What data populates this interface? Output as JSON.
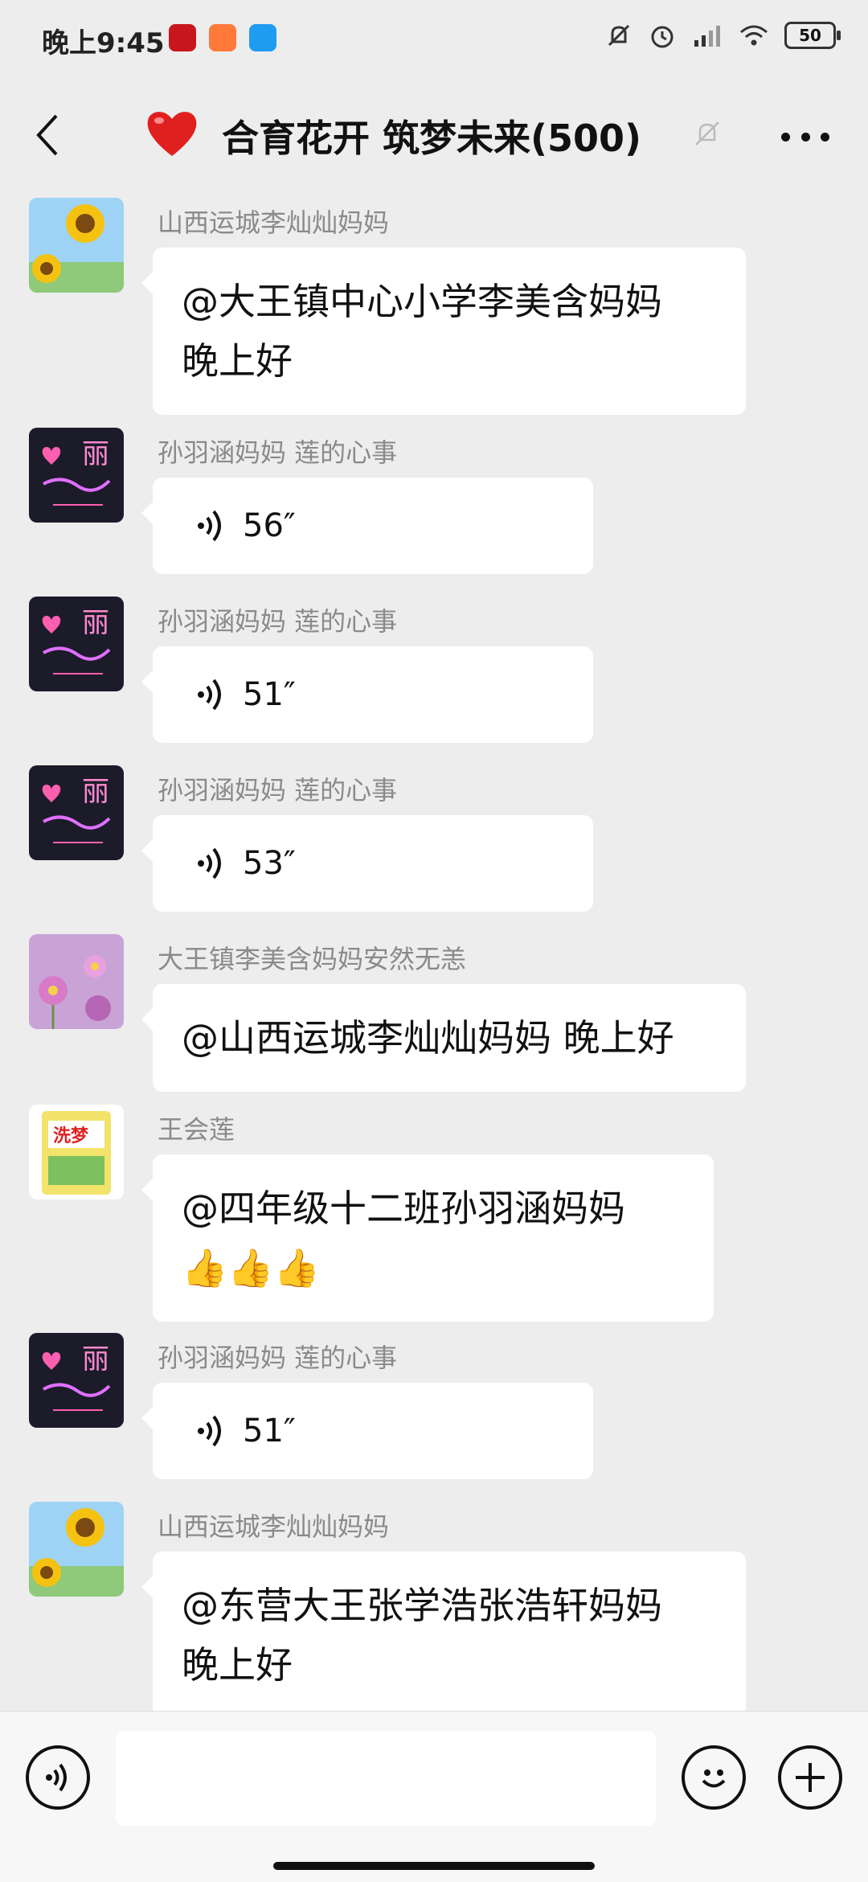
{
  "status_bar": {
    "time": "晚上9:45",
    "battery": "50"
  },
  "header": {
    "title": "合育花开 筑梦未来(500)"
  },
  "messages": [
    {
      "sender": "山西运城李灿灿妈妈",
      "type": "text",
      "lines": [
        "@大王镇中心小学李美含妈妈",
        "晚上好"
      ],
      "avatar": "sunflower-avatar"
    },
    {
      "sender": "孙羽涵妈妈  莲的心事",
      "type": "voice",
      "duration": "56″",
      "avatar": "neon-heart-avatar"
    },
    {
      "sender": "孙羽涵妈妈  莲的心事",
      "type": "voice",
      "duration": "51″",
      "avatar": "neon-heart-avatar"
    },
    {
      "sender": "孙羽涵妈妈  莲的心事",
      "type": "voice",
      "duration": "53″",
      "avatar": "neon-heart-avatar"
    },
    {
      "sender": "大王镇李美含妈妈安然无恙",
      "type": "text",
      "lines": [
        "@山西运城李灿灿妈妈  晚上好"
      ],
      "avatar": "purple-flowers-avatar"
    },
    {
      "sender": "王会莲",
      "type": "text",
      "lines": [
        "@四年级十二班孙羽涵妈妈",
        "👍👍👍"
      ],
      "avatar": "detergent-package-avatar"
    },
    {
      "sender": "孙羽涵妈妈  莲的心事",
      "type": "voice",
      "duration": "51″",
      "avatar": "neon-heart-avatar"
    },
    {
      "sender": "山西运城李灿灿妈妈",
      "type": "text",
      "lines": [
        "@东营大王张学浩张浩轩妈妈",
        "晚上好"
      ],
      "avatar": "sunflower-avatar"
    }
  ],
  "avatar_labels": {
    "neon_char": "丽",
    "detergent_brand": "洗梦"
  },
  "composer": {
    "input_value": ""
  },
  "colors": {
    "background": "#ededed",
    "bubble": "#ffffff",
    "sender": "#8a8a8a",
    "heart": "#e0201e"
  }
}
